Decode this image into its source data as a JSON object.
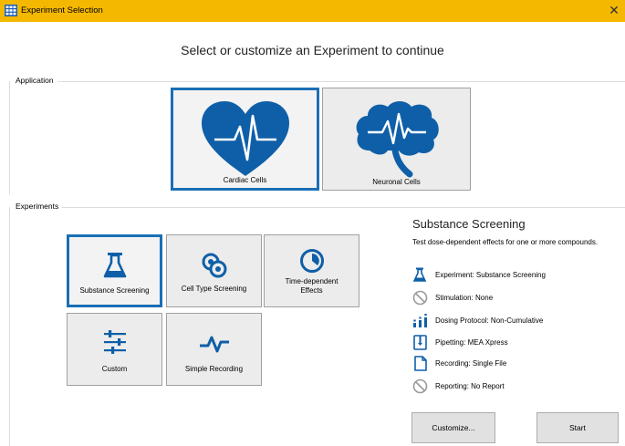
{
  "window": {
    "title": "Experiment Selection",
    "close_glyph": "✕"
  },
  "heading": "Select or customize an Experiment to continue",
  "application": {
    "group_label": "Application",
    "cards": [
      {
        "label": "Cardiac Cells",
        "icon": "heart-pulse-icon",
        "selected": true
      },
      {
        "label": "Neuronal Cells",
        "icon": "brain-pulse-icon",
        "selected": false
      }
    ]
  },
  "experiments": {
    "group_label": "Experiments",
    "tiles": [
      {
        "label": "Substance Screening",
        "icon": "flask-icon",
        "selected": true
      },
      {
        "label": "Cell Type Screening",
        "icon": "cells-icon",
        "selected": false
      },
      {
        "label": "Time-dependent Effects",
        "label_line1": "Time-dependent",
        "label_line2": "Effects",
        "icon": "clock-icon",
        "selected": false
      },
      {
        "label": "Custom",
        "icon": "sliders-icon",
        "selected": false
      },
      {
        "label": "Simple Recording",
        "icon": "pulse-icon",
        "selected": false
      }
    ]
  },
  "details": {
    "title": "Substance Screening",
    "description": "Test dose-dependent effects for one or more compounds.",
    "rows": [
      {
        "icon": "flask-icon",
        "text": "Experiment: Substance Screening"
      },
      {
        "icon": "prohibited-icon",
        "text": "Stimulation: None"
      },
      {
        "icon": "dosing-bars-icon",
        "text": "Dosing Protocol: Non-Cumulative"
      },
      {
        "icon": "pipette-icon",
        "text": "Pipetting: MEA Xpress"
      },
      {
        "icon": "file-icon",
        "text": "Recording: Single File"
      },
      {
        "icon": "prohibited-icon",
        "text": "Reporting: No Report"
      }
    ]
  },
  "buttons": {
    "customize": "Customize...",
    "start": "Start"
  },
  "colors": {
    "titlebar": "#f5b800",
    "accent": "#1a6fb5",
    "tile_bg": "#ececec",
    "icon_blue": "#0f5fa8"
  }
}
